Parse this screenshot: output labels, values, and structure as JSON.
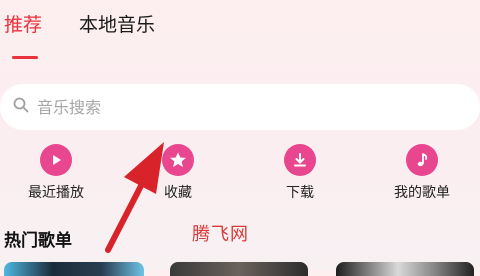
{
  "tabs": [
    {
      "label": "推荐",
      "active": true
    },
    {
      "label": "本地音乐",
      "active": false
    }
  ],
  "search": {
    "placeholder": "音乐搜索"
  },
  "quick_actions": [
    {
      "label": "最近播放",
      "icon": "play-icon"
    },
    {
      "label": "收藏",
      "icon": "star-icon"
    },
    {
      "label": "下载",
      "icon": "download-icon"
    },
    {
      "label": "我的歌单",
      "icon": "music-note-icon"
    }
  ],
  "section": {
    "title": "热门歌单"
  },
  "watermark": "腾飞网",
  "colors": {
    "accent": "#e8323c",
    "icon_bg": "#e8478f",
    "arrow": "#d8232a"
  }
}
